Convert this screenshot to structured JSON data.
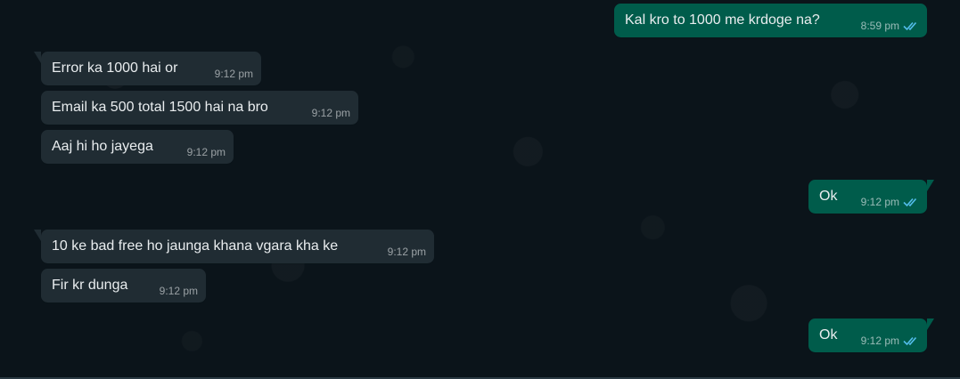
{
  "colors": {
    "background": "#0b141a",
    "incoming_bubble": "#202c33",
    "outgoing_bubble": "#005c4b",
    "read_tick": "#53bdeb"
  },
  "messages": [
    {
      "direction": "outgoing",
      "text": "Kal kro to 1000 me krdoge na?",
      "time": "8:59 pm",
      "status": "read"
    },
    {
      "direction": "incoming",
      "text": "Error ka 1000 hai or",
      "time": "9:12 pm"
    },
    {
      "direction": "incoming",
      "text": "Email ka 500 total 1500 hai na bro",
      "time": "9:12 pm"
    },
    {
      "direction": "incoming",
      "text": "Aaj hi ho jayega",
      "time": "9:12 pm"
    },
    {
      "direction": "outgoing",
      "text": "Ok",
      "time": "9:12 pm",
      "status": "read"
    },
    {
      "direction": "incoming",
      "text": "10 ke bad free ho jaunga khana vgara kha ke",
      "time": "9:12 pm"
    },
    {
      "direction": "incoming",
      "text": "Fir kr dunga",
      "time": "9:12 pm"
    },
    {
      "direction": "outgoing",
      "text": "Ok",
      "time": "9:12 pm",
      "status": "read"
    }
  ]
}
